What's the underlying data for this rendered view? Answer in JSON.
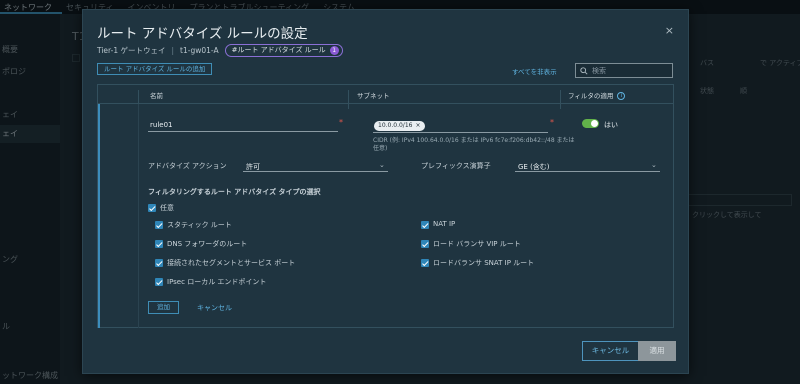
{
  "background": {
    "topnav": [
      "ネットワーク",
      "セキュリティ",
      "インベントリ",
      "プランとトラブルシューティング",
      "システム"
    ],
    "sidebar": [
      "概要",
      "ポロジ",
      "ェイ",
      "ェイ",
      "ング",
      "ル",
      "ットワーク構成"
    ],
    "fragments": [
      "T1",
      "状態",
      "順",
      "バス",
      "で アクティブ",
      "クリックして表示して"
    ]
  },
  "modal": {
    "title": "ルート アドバタイズ ルールの設定",
    "close": "×",
    "breadcrumb": {
      "gateway_type": "Tier-1 ゲートウェイ",
      "gateway_name": "t1-gw01-A",
      "rule_pill": "#ルート アドバタイズ ルール",
      "rule_count": "1"
    },
    "add_rule_button": "ルート アドバタイズ ルールの追加",
    "hide_all": "すべてを非表示",
    "search_placeholder": "検索",
    "table": {
      "headers": {
        "name": "名前",
        "subnet": "サブネット",
        "filter": "フィルタの適用"
      },
      "row": {
        "name": "rule01",
        "subnet_chip": "10.0.0.0/16",
        "subnet_hint": "CIDR (例: IPv4 100.64.0.0/16 または IPv6 fc7e:f206:db42::/48 または 任意)",
        "filter_label": "はい",
        "filter_enabled": true,
        "advertise_action_label": "アドバタイズ アクション",
        "advertise_action_value": "許可",
        "prefix_operator_label": "プレフィックス演算子",
        "prefix_operator_value": "GE (含む)",
        "filter_types_title": "フィルタリングするルート アドバタイズ タイプの選択",
        "any_label": "任意",
        "types_left": [
          "スタティック ルート",
          "DNS フォワーダのルート",
          "接続されたセグメントとサービス ポート",
          "IPsec ローカル エンドポイント"
        ],
        "types_right": [
          "NAT IP",
          "ロード バランサ VIP ルート",
          "ロードバランサ SNAT IP ルート"
        ],
        "add_button": "追加",
        "cancel_link": "キャンセル"
      }
    },
    "footer": {
      "cancel": "キャンセル",
      "apply": "適用"
    }
  }
}
